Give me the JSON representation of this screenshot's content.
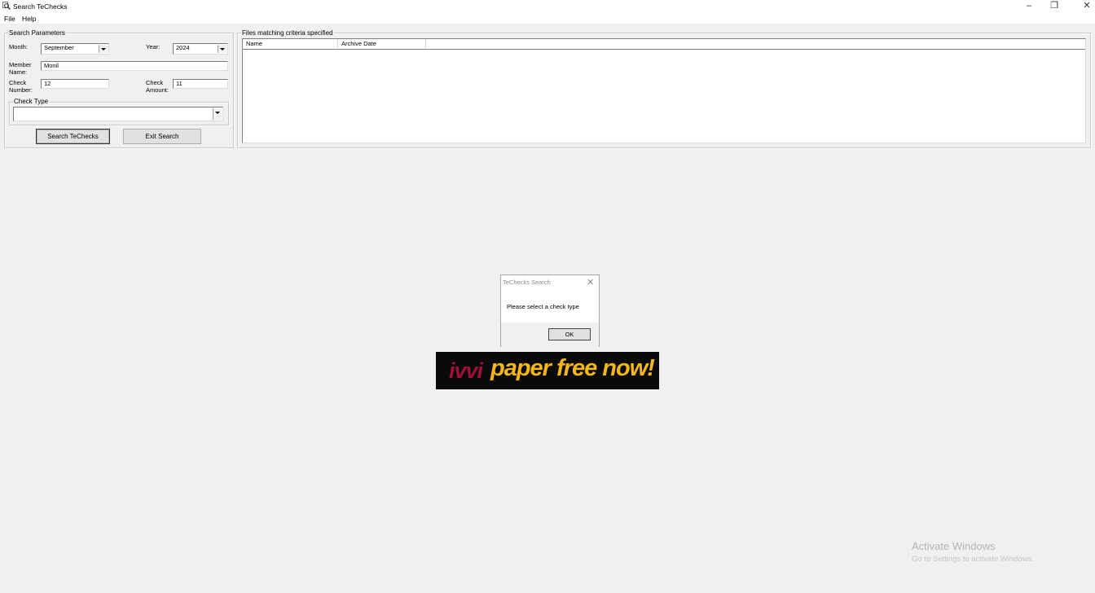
{
  "window": {
    "title": "Search TeChecks",
    "minimize_glyph": "–",
    "restore_glyph": "❐",
    "close_glyph": "✕"
  },
  "menu": [
    "File",
    "Help"
  ],
  "search_params": {
    "legend": "Search Parameters",
    "month_label": "Month:",
    "month_value": "September",
    "year_label": "Year:",
    "year_value": "2024",
    "member_label_1": "Member",
    "member_label_2": "Name:",
    "member_value": "Monil",
    "check_number_label_1": "Check",
    "check_number_label_2": "Number:",
    "check_number_value": "12",
    "check_amount_label_1": "Check",
    "check_amount_label_2": "Amount:",
    "check_amount_value": "11",
    "check_type_legend": "Check Type",
    "check_type_value": "",
    "search_button": "Search TeChecks",
    "exit_button": "Exit Search"
  },
  "results": {
    "legend": "Files matching criteria specified",
    "columns": [
      "Name",
      "Archive Date"
    ]
  },
  "dialog": {
    "title": "TeChecks Search",
    "close_glyph": "✕",
    "message": "Please select a check type",
    "ok_label": "OK"
  },
  "banner": {
    "brand": "ivvi",
    "tagline": "paper free now!"
  },
  "watermark": {
    "line1": "Activate Windows",
    "line2": "Go to Settings to activate Windows."
  },
  "icons": {
    "app": "search-magnifier-icon",
    "combo": "chevron-down-icon"
  }
}
